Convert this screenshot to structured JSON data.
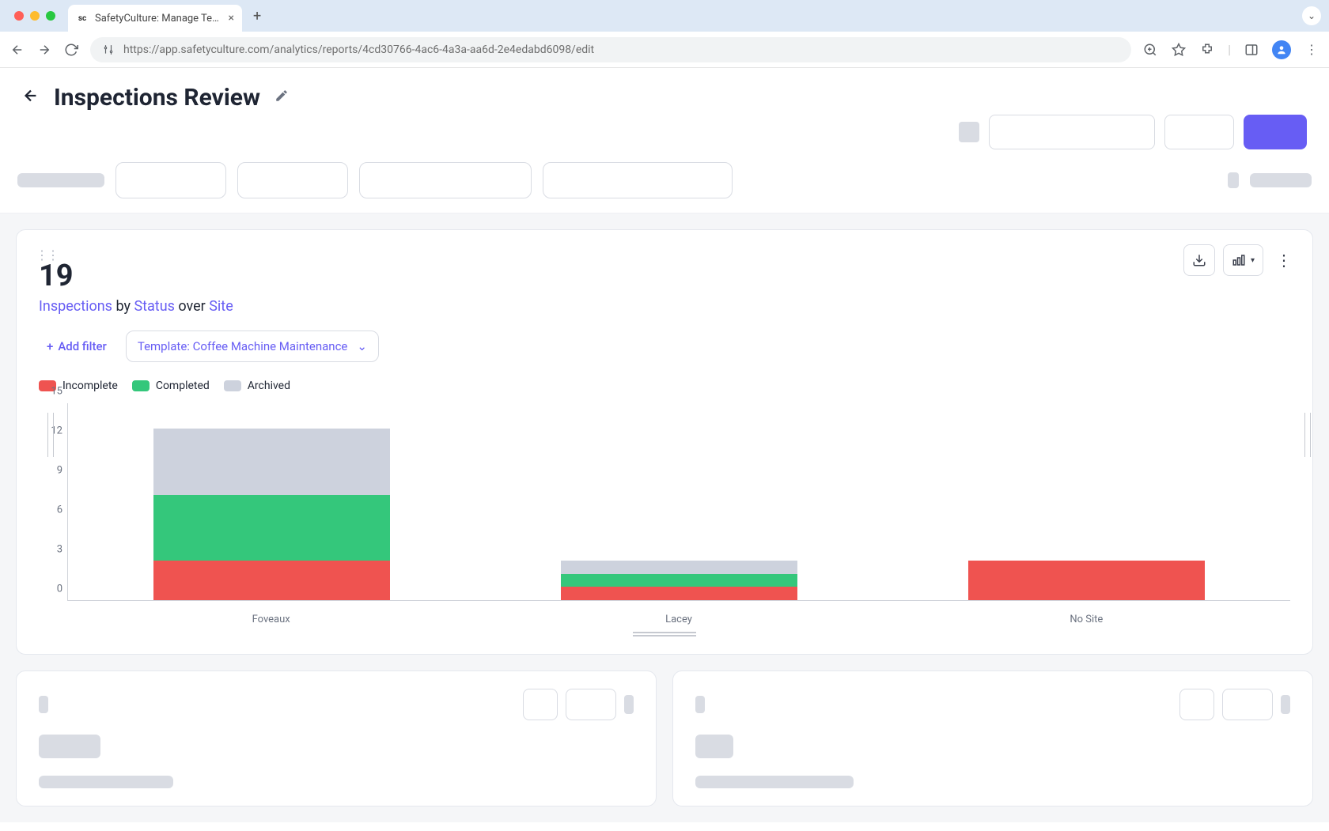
{
  "browser": {
    "tab_title": "SafetyCulture: Manage Teams and...",
    "url": "https://app.safetyculture.com/analytics/reports/4cd30766-4ac6-4a3a-aa6d-2e4edabd6098/edit"
  },
  "page": {
    "title": "Inspections Review"
  },
  "widget": {
    "metric": "19",
    "subtitle_parts": {
      "inspections": "Inspections",
      "by": "by",
      "status": "Status",
      "over": "over",
      "site": "Site"
    },
    "add_filter_label": "Add filter",
    "template_filter": "Template: Coffee Machine Maintenance",
    "legend": [
      {
        "label": "Incomplete",
        "color": "#ef5350"
      },
      {
        "label": "Completed",
        "color": "#34c77b"
      },
      {
        "label": "Archived",
        "color": "#cdd2dd"
      }
    ]
  },
  "chart_data": {
    "type": "bar",
    "stacked": true,
    "ylim": [
      0,
      15
    ],
    "yticks": [
      0,
      3,
      6,
      9,
      12,
      15
    ],
    "categories": [
      "Foveaux",
      "Lacey",
      "No Site"
    ],
    "series": [
      {
        "name": "Incomplete",
        "color": "#ef5350",
        "values": [
          3,
          1,
          3
        ]
      },
      {
        "name": "Completed",
        "color": "#34c77b",
        "values": [
          5,
          1,
          0
        ]
      },
      {
        "name": "Archived",
        "color": "#cdd2dd",
        "values": [
          5,
          1,
          0
        ]
      }
    ],
    "ylabel": "",
    "xlabel": ""
  }
}
